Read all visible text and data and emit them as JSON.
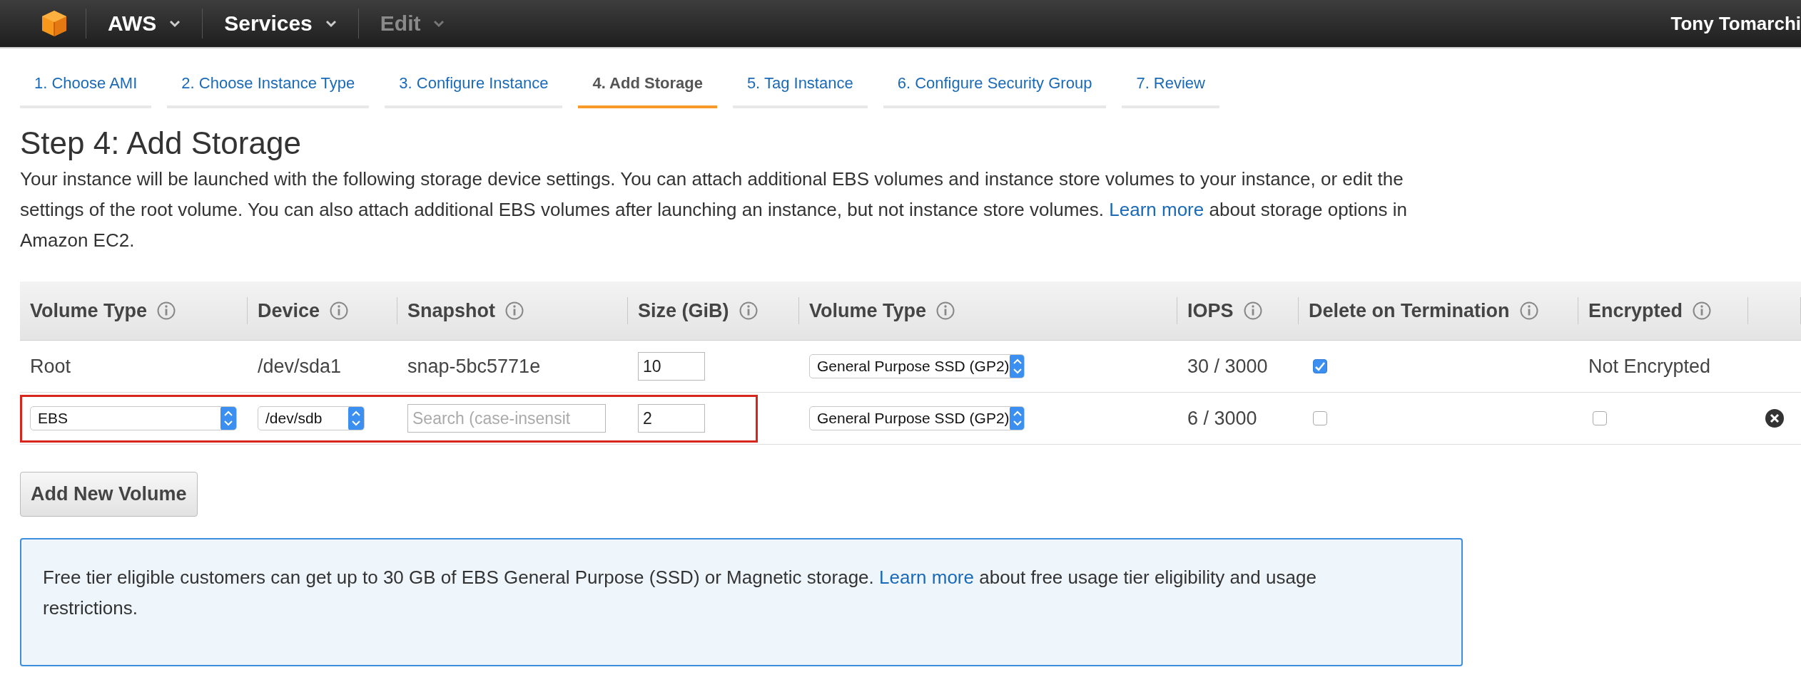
{
  "topbar": {
    "menus": [
      {
        "label": "AWS",
        "disabled": false
      },
      {
        "label": "Services",
        "disabled": false
      },
      {
        "label": "Edit",
        "disabled": true
      }
    ],
    "user": "Tony Tomarchi"
  },
  "steps": [
    {
      "label": "1. Choose AMI",
      "selected": false
    },
    {
      "label": "2. Choose Instance Type",
      "selected": false
    },
    {
      "label": "3. Configure Instance",
      "selected": false
    },
    {
      "label": "4. Add Storage",
      "selected": true
    },
    {
      "label": "5. Tag Instance",
      "selected": false
    },
    {
      "label": "6. Configure Security Group",
      "selected": false
    },
    {
      "label": "7. Review",
      "selected": false
    }
  ],
  "title": "Step 4: Add Storage",
  "description": {
    "before": "Your instance will be launched with the following storage device settings. You can attach additional EBS volumes and instance store volumes to your instance, or edit the settings of the root volume. You can also attach additional EBS volumes after launching an instance, but not instance store volumes.",
    "link": "Learn more",
    "after": "about storage options in Amazon EC2."
  },
  "table": {
    "columns": [
      "Volume Type",
      "Device",
      "Snapshot",
      "Size (GiB)",
      "Volume Type",
      "IOPS",
      "Delete on Termination",
      "Encrypted"
    ],
    "rows": [
      {
        "kind": "root",
        "highlighted": false,
        "volume_type": "Root",
        "device": "/dev/sda1",
        "snapshot": "snap-5bc5771e",
        "size": "10",
        "volume_kind": "General Purpose SSD (GP2)",
        "iops": "30 / 3000",
        "delete_on_termination": true,
        "encryption": "Not Encrypted"
      },
      {
        "kind": "ebs",
        "highlighted": true,
        "volume_type": "EBS",
        "device": "/dev/sdb",
        "snapshot_placeholder": "Search (case-insensit",
        "size": "2",
        "volume_kind": "General Purpose SSD (GP2)",
        "iops": "6 / 3000",
        "delete_on_termination": false,
        "encrypted": false
      }
    ]
  },
  "add_button": "Add New Volume",
  "notice": {
    "before": "Free tier eligible customers can get up to 30 GB of EBS General Purpose (SSD) or Magnetic storage.",
    "link": "Learn more",
    "after": "about free usage tier eligibility and usage restrictions."
  }
}
